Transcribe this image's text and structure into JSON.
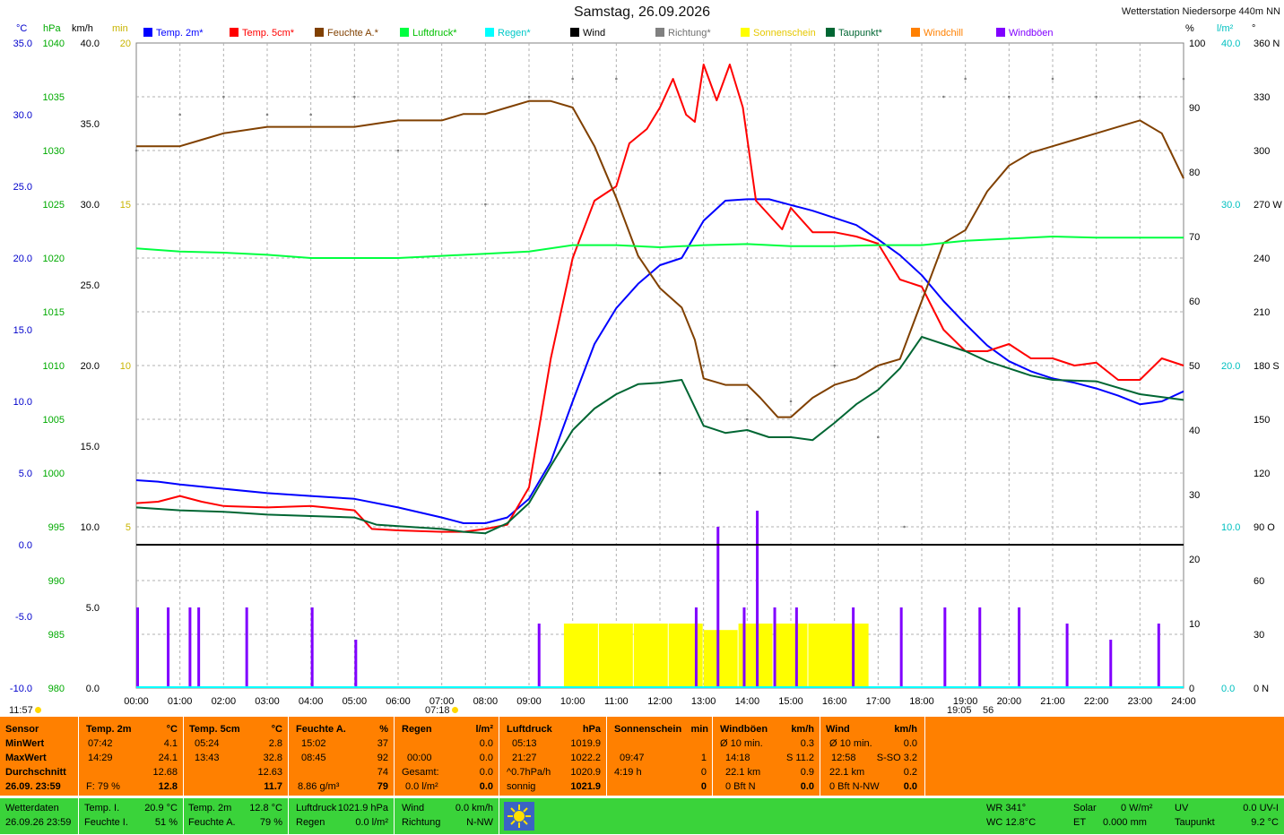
{
  "header": {
    "title": "Samstag, 26.09.2026",
    "station": "Wetterstation Niedersorpe 440m NN",
    "units_left": [
      "°C",
      "hPa",
      "km/h",
      "min"
    ],
    "units_right": [
      "%",
      "l/m²",
      "°"
    ]
  },
  "legend": [
    {
      "label": "Temp. 2m*",
      "color": "#0000ff"
    },
    {
      "label": "Temp. 5cm*",
      "color": "#ff0000"
    },
    {
      "label": "Feuchte A.*",
      "color": "#804000"
    },
    {
      "label": "Luftdruck*",
      "color": "#00ff40"
    },
    {
      "label": "Regen*",
      "color": "#00ffff"
    },
    {
      "label": "Wind",
      "color": "#000000"
    },
    {
      "label": "Richtung*",
      "color": "#808080"
    },
    {
      "label": "Sonnenschein",
      "color": "#ffff00"
    },
    {
      "label": "Taupunkt*",
      "color": "#006633"
    },
    {
      "label": "Windchill",
      "color": "#ff8000"
    },
    {
      "label": "Windböen",
      "color": "#8000ff"
    }
  ],
  "sunrise": "07:18",
  "sunset": "19:05",
  "sunrise_prev_marker": "11:57",
  "sunset_suffix": "56",
  "chart_data": {
    "type": "line",
    "x_unit": "time of day",
    "x_ticks": [
      "00:00",
      "01:00",
      "02:00",
      "03:00",
      "04:00",
      "05:00",
      "06:00",
      "07:00",
      "08:00",
      "09:00",
      "10:00",
      "11:00",
      "12:00",
      "13:00",
      "14:00",
      "15:00",
      "16:00",
      "17:00",
      "18:00",
      "19:00",
      "20:00",
      "21:00",
      "22:00",
      "23:00",
      "24:00"
    ],
    "axes": {
      "temp_c": {
        "ticks": [
          "35.0",
          "30.0",
          "25.0",
          "20.0",
          "15.0",
          "10.0",
          "5.0",
          "0.0",
          "-5.0",
          "-10.0"
        ],
        "range": [
          -10,
          35
        ],
        "color": "#0000cc"
      },
      "pressure_hpa": {
        "ticks": [
          "1040",
          "1035",
          "1030",
          "1025",
          "1020",
          "1015",
          "1010",
          "1005",
          "1000",
          "995",
          "990",
          "985",
          "980"
        ],
        "range": [
          980,
          1040
        ],
        "color": "#00aa00"
      },
      "wind_kmh": {
        "ticks": [
          "40.0",
          "35.0",
          "30.0",
          "25.0",
          "20.0",
          "15.0",
          "10.0",
          "5.0",
          "0.0"
        ],
        "range": [
          0,
          40
        ],
        "color": "#000000"
      },
      "sun_min": {
        "ticks": [
          "20",
          "15",
          "10",
          "5"
        ],
        "range": [
          0,
          20
        ],
        "color": "#c8b400"
      },
      "humidity_pct": {
        "ticks": [
          "100",
          "90",
          "80",
          "70",
          "60",
          "50",
          "40",
          "30",
          "20",
          "10",
          "0"
        ],
        "range": [
          0,
          100
        ],
        "color": "#000000"
      },
      "rain_lm2": {
        "ticks": [
          "40.0",
          "30.0",
          "20.0",
          "10.0",
          "0.0"
        ],
        "range": [
          0,
          40
        ],
        "color": "#00c0c0"
      },
      "direction_deg": {
        "ticks": [
          "360 N",
          "330",
          "300",
          "270 W",
          "240",
          "210",
          "180 S",
          "150",
          "120",
          "90 O",
          "60",
          "30",
          "0 N"
        ],
        "range": [
          0,
          360
        ],
        "color": "#000000"
      }
    },
    "series": [
      {
        "name": "Temp. 2m*",
        "axis": "temp_c",
        "color": "#0000ff",
        "x": [
          0,
          0.5,
          1,
          2,
          3,
          4,
          5,
          6,
          7,
          7.5,
          8,
          8.5,
          9,
          9.5,
          10,
          10.5,
          11,
          11.5,
          12,
          12.5,
          13,
          13.5,
          14,
          14.5,
          15,
          15.5,
          16,
          16.5,
          17,
          17.5,
          18,
          18.5,
          19,
          19.5,
          20,
          20.5,
          21,
          21.5,
          22,
          22.5,
          23,
          23.5,
          24
        ],
        "y": [
          4.5,
          4.4,
          4.2,
          3.9,
          3.6,
          3.4,
          3.2,
          2.6,
          1.9,
          1.5,
          1.5,
          1.9,
          3.2,
          5.8,
          10.0,
          14.0,
          16.5,
          18.2,
          19.5,
          20.0,
          22.6,
          24.0,
          24.1,
          24.1,
          23.7,
          23.3,
          22.8,
          22.3,
          21.3,
          20.2,
          18.8,
          17.0,
          15.4,
          13.9,
          12.8,
          12.1,
          11.6,
          11.3,
          10.9,
          10.4,
          9.8,
          10.0,
          10.7
        ]
      },
      {
        "name": "Temp. 5cm*",
        "axis": "temp_c",
        "color": "#ff0000",
        "x": [
          0,
          0.5,
          1,
          1.5,
          2,
          3,
          4,
          5,
          5.4,
          6,
          7,
          7.5,
          8,
          8.5,
          9,
          9.5,
          10,
          10.5,
          11,
          11.3,
          11.7,
          12,
          12.3,
          12.6,
          12.8,
          13,
          13.3,
          13.6,
          13.9,
          14.2,
          14.5,
          14.8,
          15,
          15.5,
          16,
          16.5,
          17,
          17.5,
          18,
          18.5,
          19,
          19.5,
          20,
          20.5,
          21,
          21.5,
          22,
          22.5,
          23,
          23.5,
          24
        ],
        "y": [
          2.9,
          3.0,
          3.4,
          3.0,
          2.7,
          2.6,
          2.7,
          2.4,
          1.1,
          1.0,
          0.9,
          0.9,
          1.1,
          1.4,
          4.0,
          13.0,
          20.0,
          24.0,
          25.0,
          28.0,
          29.0,
          30.5,
          32.5,
          30.0,
          29.5,
          33.5,
          31.0,
          33.5,
          30.5,
          24.0,
          23.0,
          22.0,
          23.5,
          21.8,
          21.8,
          21.5,
          21.0,
          18.5,
          18.0,
          15.0,
          13.5,
          13.5,
          14.0,
          13.0,
          13.0,
          12.5,
          12.7,
          11.5,
          11.5,
          13.0,
          12.5
        ]
      },
      {
        "name": "Feuchte A.*",
        "axis": "humidity_pct",
        "color": "#804000",
        "x": [
          0,
          0.5,
          1,
          1.5,
          2,
          3,
          4,
          5,
          6,
          7,
          7.5,
          8,
          8.5,
          9,
          9.5,
          10,
          10.5,
          11,
          11.5,
          12,
          12.5,
          12.8,
          13,
          13.5,
          14,
          14.3,
          14.7,
          15,
          15.5,
          16,
          16.5,
          17,
          17.5,
          18,
          18.5,
          19,
          19.5,
          20,
          20.5,
          21,
          21.5,
          22,
          22.5,
          23,
          23.5,
          24
        ],
        "y": [
          84,
          84,
          84,
          85,
          86,
          87,
          87,
          87,
          88,
          88,
          89,
          89,
          90,
          91,
          91,
          90,
          84,
          76,
          67,
          62,
          59,
          54,
          48,
          47,
          47,
          45,
          42,
          42,
          45,
          47,
          48,
          50,
          51,
          60,
          69,
          71,
          77,
          81,
          83,
          84,
          85,
          86,
          87,
          88,
          86,
          79
        ]
      },
      {
        "name": "Luftdruck*",
        "axis": "pressure_hpa",
        "color": "#00ff40",
        "x": [
          0,
          1,
          2,
          3,
          4,
          5,
          6,
          7,
          8,
          9,
          10,
          11,
          12,
          13,
          14,
          15,
          16,
          17,
          18,
          19,
          20,
          21,
          22,
          23,
          24
        ],
        "y": [
          1020.9,
          1020.6,
          1020.5,
          1020.3,
          1020.0,
          1020.0,
          1020.0,
          1020.2,
          1020.4,
          1020.6,
          1021.2,
          1021.2,
          1021.0,
          1021.2,
          1021.3,
          1021.1,
          1021.1,
          1021.2,
          1021.2,
          1021.6,
          1021.8,
          1022.0,
          1021.9,
          1021.9,
          1021.9
        ]
      },
      {
        "name": "Taupunkt*",
        "axis": "temp_c",
        "color": "#006633",
        "x": [
          0,
          1,
          2,
          3,
          4,
          5,
          5.5,
          6,
          7,
          7.5,
          8,
          8.5,
          9,
          9.5,
          10,
          10.5,
          11,
          11.5,
          12,
          12.5,
          13,
          13.5,
          14,
          14.5,
          15,
          15.5,
          16,
          16.5,
          17,
          17.5,
          18,
          18.5,
          19,
          19.5,
          20,
          20.5,
          21,
          22,
          23,
          24
        ],
        "y": [
          2.6,
          2.4,
          2.3,
          2.1,
          2.0,
          1.9,
          1.4,
          1.3,
          1.1,
          0.9,
          0.8,
          1.5,
          2.9,
          5.5,
          8.0,
          9.5,
          10.5,
          11.2,
          11.3,
          11.5,
          8.3,
          7.8,
          8.0,
          7.5,
          7.5,
          7.3,
          8.5,
          9.8,
          10.8,
          12.3,
          14.5,
          14.0,
          13.5,
          12.8,
          12.3,
          11.8,
          11.5,
          11.4,
          10.5,
          10.1
        ]
      }
    ],
    "wind_gusts_kmh": {
      "x": [
        0,
        0.7,
        1.2,
        1.4,
        2.5,
        4.0,
        5.0,
        9.2,
        12.8,
        13.3,
        13.9,
        14.2,
        14.6,
        15.1,
        16.4,
        17.5,
        18.5,
        19.3,
        20.2,
        21.3,
        22.3,
        23.4
      ],
      "y": [
        5,
        5,
        5,
        5,
        5,
        5,
        3,
        4,
        5,
        10,
        5,
        11,
        5,
        5,
        5,
        5,
        5,
        5,
        5,
        4,
        3,
        4
      ]
    },
    "sunshine_min": {
      "x": [
        9.8,
        10.6,
        11.4,
        12.2,
        13.0,
        13.8,
        14.6,
        15.4,
        16.0
      ],
      "y": [
        2,
        2,
        2,
        2,
        1.8,
        2,
        2,
        2,
        2
      ]
    },
    "direction_deg": {
      "x": [
        0,
        1,
        2,
        3,
        4,
        5,
        6,
        8,
        9,
        10,
        11,
        12,
        13,
        14,
        15,
        16,
        17,
        17.6,
        18.5,
        19,
        20,
        21,
        22,
        23,
        24
      ],
      "y": [
        300,
        320,
        330,
        320,
        320,
        330,
        300,
        270,
        330,
        340,
        340,
        120,
        180,
        150,
        160,
        180,
        140,
        90,
        330,
        340,
        330,
        340,
        330,
        330,
        340
      ]
    },
    "wind_kmh_line": 0.0,
    "ylim_pressure": [
      980,
      1040
    ]
  },
  "table": {
    "sensor": {
      "h": "Sensor",
      "r1": "MinWert",
      "r2": "MaxWert",
      "r3": "Durchschnitt",
      "r4": "26.09. 23:59"
    },
    "t2m": {
      "h": "Temp. 2m",
      "u": "°C",
      "r1a": "07:42",
      "r1b": "4.1",
      "r2a": "14:29",
      "r2b": "24.1",
      "r3b": "12.68",
      "r4a": "F: 79 %",
      "r4b": "12.8"
    },
    "t5cm": {
      "h": "Temp. 5cm",
      "u": "°C",
      "r1a": "05:24",
      "r1b": "2.8",
      "r2a": "13:43",
      "r2b": "32.8",
      "r3b": "12.63",
      "r4b": "11.7"
    },
    "hum": {
      "h": "Feuchte A.",
      "u": "%",
      "r1a": "15:02",
      "r1b": "37",
      "r2a": "08:45",
      "r2b": "92",
      "r3b": "74",
      "r4a": "8.86 g/m³",
      "r4b": "79"
    },
    "rain": {
      "h": "Regen",
      "u": "l/m²",
      "r2a": "00:00",
      "r2b": "0.0",
      "r3a": "Gesamt:",
      "r3b": "0.0",
      "r4a": "0.0 l/m²",
      "r4b": "0.0",
      "r1b": "0.0"
    },
    "press": {
      "h": "Luftdruck",
      "u": "hPa",
      "r1a": "05:13",
      "r1b": "1019.9",
      "r2a": "21:27",
      "r2b": "1022.2",
      "r3a": "^0.7hPa/h",
      "r3b": "1020.9",
      "r4a": "sonnig",
      "r4b": "1021.9"
    },
    "sun": {
      "h": "Sonnenschein",
      "u": "min",
      "r2a": "09:47",
      "r2b": "1",
      "r3a": "4:19 h",
      "r3b": "0",
      "r4b": "0"
    },
    "gust": {
      "h": "Windböen",
      "u": "km/h",
      "r1a": "Ø 10 min.",
      "r1b": "0.3",
      "r2a": "14:18",
      "r2b": "S 11.2",
      "r3a": "22.1 km",
      "r3b": "0.9",
      "r4a": "0 Bft N",
      "r4b": "0.0"
    },
    "wind": {
      "h": "Wind",
      "u": "km/h",
      "r1a": "Ø 10 min.",
      "r1b": "0.0",
      "r2a": "12:58",
      "r2b": "S-SO 3.2",
      "r3a": "22.1 km",
      "r3b": "0.2",
      "r4a": "0 Bft N-NW",
      "r4b": "0.0"
    }
  },
  "status": {
    "c1a": "Wetterdaten",
    "c1b": "26.09.26 23:59",
    "c2a": "Temp. I.",
    "c2av": "20.9 °C",
    "c2b": "Feuchte I.",
    "c2bv": "51 %",
    "c3a": "Temp. 2m",
    "c3av": "12.8 °C",
    "c3b": "Feuchte A.",
    "c3bv": "79 %",
    "c4a": "Luftdruck",
    "c4av": "1021.9 hPa",
    "c4b": "Regen",
    "c4bv": "0.0 l/m²",
    "c5a": "Wind",
    "c5av": "0.0 km/h",
    "c5b": "Richtung",
    "c5bv": "N-NW",
    "c6a": "WR 341°",
    "c6b": "WC 12.8°C",
    "c7a": "Solar",
    "c7av": "0 W/m²",
    "c7b": "ET",
    "c7bv": "0.000 mm",
    "c8a": "UV",
    "c8av": "0.0 UV-I",
    "c8b": "Taupunkt",
    "c8bv": "9.2 °C"
  }
}
